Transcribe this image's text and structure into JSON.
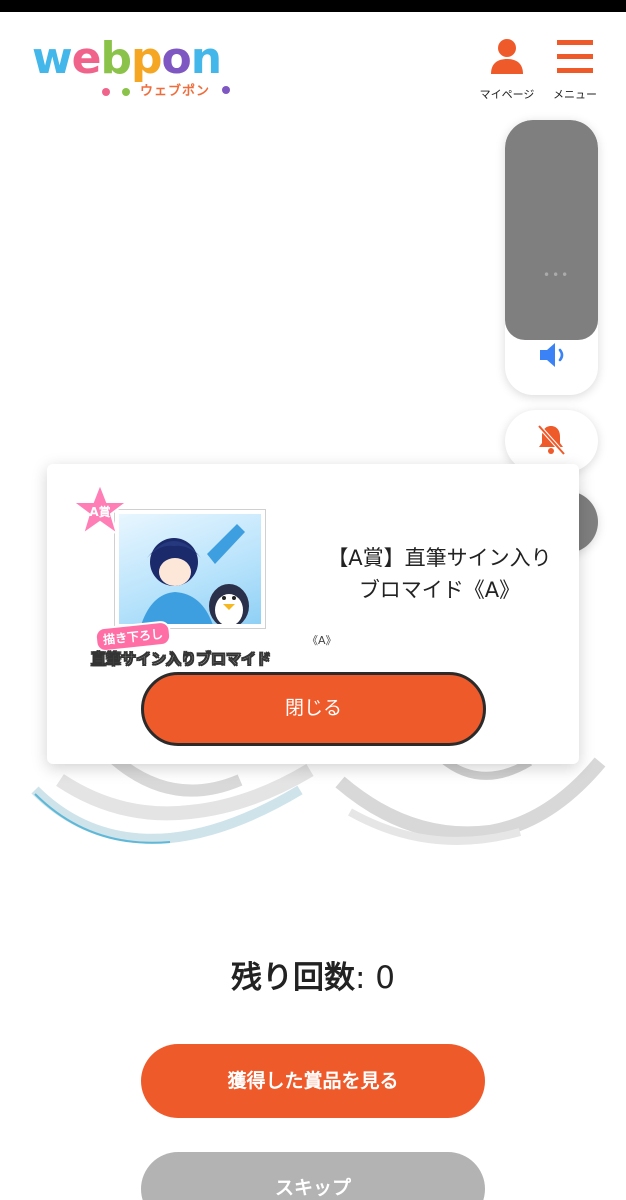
{
  "header": {
    "logo": {
      "wordmark": "webpon",
      "katakana": "ウェブポン"
    },
    "nav": {
      "mypage_label": "マイページ",
      "menu_label": "メニュー"
    }
  },
  "controls": {
    "volume_level": 0.0,
    "volume_icon": "speaker-icon",
    "mute_icon": "bell-off-icon",
    "theme_icon": "moon-icon"
  },
  "modal": {
    "badge_text": "A賞",
    "sublabel": "描き下ろし",
    "image_caption": "直筆サイン入りブロマイド",
    "image_variant_mark": "《A》",
    "prize_title": "【A賞】直筆サイン入りブロマイド《A》",
    "close_label": "閉じる"
  },
  "remaining": {
    "label": "残り回数",
    "separator": ": ",
    "count": "0"
  },
  "actions": {
    "view_prizes_label": "獲得した賞品を見る",
    "skip_label": "スキップ"
  },
  "colors": {
    "accent": "#ef5a2b",
    "panel_gray": "#7f7f7f",
    "volume_blue": "#3b82f6",
    "mute_red": "#ef5a2b"
  }
}
